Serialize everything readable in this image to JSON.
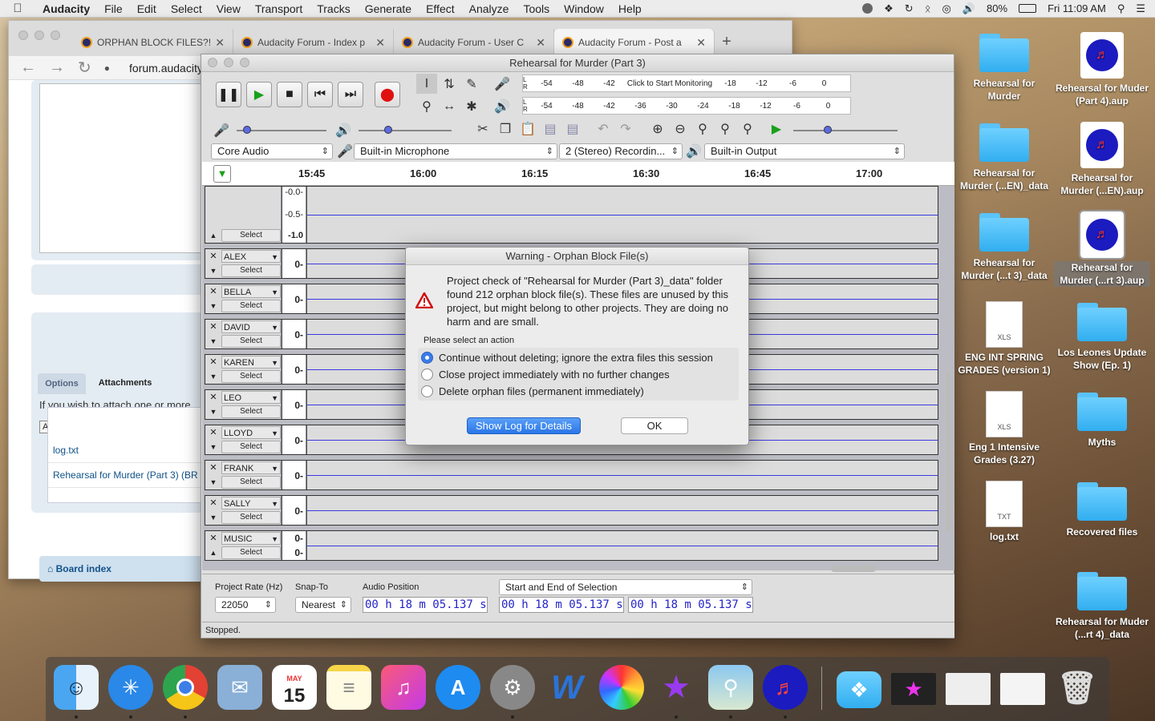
{
  "menubar": {
    "apple": "",
    "app": "Audacity",
    "items": [
      "File",
      "Edit",
      "Select",
      "View",
      "Transport",
      "Tracks",
      "Generate",
      "Effect",
      "Analyze",
      "Tools",
      "Window",
      "Help"
    ],
    "battery": "80%",
    "clock": "Fri 11:09 AM"
  },
  "browser": {
    "tabs": [
      {
        "title": "ORPHAN BLOCK FILES?!"
      },
      {
        "title": "Audacity Forum - Index p"
      },
      {
        "title": "Audacity Forum - User C"
      },
      {
        "title": "Audacity Forum - Post a"
      }
    ],
    "url": "forum.audacity",
    "tab_options": "Options",
    "tab_attachments": "Attachments",
    "attach_text": "If you wish to attach one or more",
    "add_files": "Add files",
    "files": [
      "log.txt",
      "Rehearsal for Murder (Part 3) (BR"
    ],
    "board_index": "Board index"
  },
  "audacity": {
    "title": "Rehearsal for Murder (Part 3)",
    "meter_rec": [
      "-54",
      "-48",
      "-42",
      "Click to Start Monitoring",
      "-18",
      "-12",
      "-6",
      "0"
    ],
    "meter_play": [
      "-54",
      "-48",
      "-42",
      "-36",
      "-30",
      "-24",
      "-18",
      "-12",
      "-6",
      "0"
    ],
    "host": "Core Audio",
    "rec_device": "Built-in Microphone",
    "channels": "2 (Stereo) Recordin...",
    "play_device": "Built-in Output",
    "ruler": [
      "15:45",
      "16:00",
      "16:15",
      "16:30",
      "16:45",
      "17:00"
    ],
    "first_track_scale": [
      "-0.0-",
      "-0.5-",
      "-1.0"
    ],
    "select_label": "Select",
    "tracks": [
      {
        "name": "ALEX",
        "scale": "0-"
      },
      {
        "name": "BELLA",
        "scale": "0-"
      },
      {
        "name": "DAVID",
        "scale": "0-"
      },
      {
        "name": "KAREN",
        "scale": "0-"
      },
      {
        "name": "LEO",
        "scale": "0-"
      },
      {
        "name": "LLOYD",
        "scale": "0-"
      },
      {
        "name": "FRANK",
        "scale": "0-"
      },
      {
        "name": "SALLY",
        "scale": "0-"
      },
      {
        "name": "MUSIC",
        "scale": "0-"
      }
    ],
    "music_scale_bottom": "0-",
    "project_rate_label": "Project Rate (Hz)",
    "project_rate": "22050",
    "snap_label": "Snap-To",
    "snap_value": "Nearest",
    "audio_pos_label": "Audio Position",
    "audio_pos": "00 h 18 m 05.137 s",
    "selection_mode": "Start and End of Selection",
    "sel_start": "00 h 18 m 05.137 s",
    "sel_end": "00 h 18 m 05.137 s",
    "status": "Stopped."
  },
  "dialog": {
    "title": "Warning - Orphan Block File(s)",
    "message": "Project check of \"Rehearsal for Murder (Part 3)_data\" folder found 212 orphan block file(s). These files are unused by this project, but might belong to other projects. They are doing no harm and are small.",
    "prompt": "Please select an action",
    "options": [
      "Continue without deleting; ignore the extra files this session",
      "Close project immediately with no further changes",
      "Delete orphan files (permanent immediately)"
    ],
    "selected_option": 0,
    "btn_log": "Show Log for Details",
    "btn_ok": "OK"
  },
  "desktop": [
    {
      "label": "Rehearsal for Murder",
      "type": "folder"
    },
    {
      "label": "Rehearsal for Muder (Part 4).aup",
      "type": "aup"
    },
    {
      "label": "Rehearsal for Murder (...EN)_data",
      "type": "folder"
    },
    {
      "label": "Rehearsal for Murder (...EN).aup",
      "type": "aup"
    },
    {
      "label": "Rehearsal for Murder (...t 3)_data",
      "type": "folder"
    },
    {
      "label": "Rehearsal for Murder (...rt 3).aup",
      "type": "aup"
    },
    {
      "label": "ENG INT SPRING GRADES (version 1)",
      "type": "xls"
    },
    {
      "label": "Los Leones Update Show (Ep. 1)",
      "type": "folder"
    },
    {
      "label": "Eng 1 Intensive Grades (3.27)",
      "type": "xls"
    },
    {
      "label": "Myths",
      "type": "folder"
    },
    {
      "label": "log.txt",
      "type": "txt"
    },
    {
      "label": "Recovered files",
      "type": "folder"
    },
    {
      "label": "Rehearsal for Muder (...rt 4)_data",
      "type": "folder"
    }
  ],
  "doc_badges": {
    "xls": "XLS",
    "txt": "TXT"
  },
  "calendar": {
    "month": "MAY",
    "day": "15"
  },
  "dock_icons": [
    "finder-icon",
    "safari-icon",
    "chrome-icon",
    "mail-icon",
    "calendar-icon",
    "notes-icon",
    "music-icon",
    "appstore-icon",
    "settings-icon",
    "word-icon",
    "photos-icon",
    "imovie-icon",
    "preview-icon",
    "audacity-icon",
    "downloads-folder-icon",
    "screenshot-1-icon",
    "screenshot-2-icon",
    "screenshot-3-icon",
    "trash-icon"
  ]
}
